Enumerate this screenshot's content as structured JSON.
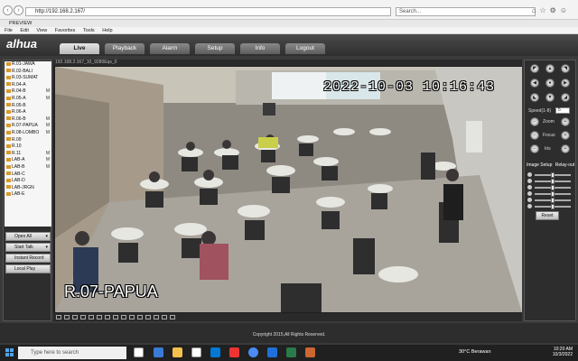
{
  "browser": {
    "address": "http://192.168.2.167/",
    "search_placeholder": "Search...",
    "tab_title": "PREVIEW",
    "menu": [
      "File",
      "Edit",
      "View",
      "Favorites",
      "Tools",
      "Help"
    ]
  },
  "app": {
    "logo": "alhua",
    "tabs": [
      "Live",
      "Playback",
      "Alarm",
      "Setup",
      "Info",
      "Logout"
    ],
    "active_tab": "Live",
    "copyright": "Copyright 2015,All Rights Reserved."
  },
  "cameras": [
    {
      "label": "R.01-JAWA",
      "m": false
    },
    {
      "label": "R.02-BALI",
      "m": false
    },
    {
      "label": "R.03-SUMAT",
      "m": false
    },
    {
      "label": "R.04-A",
      "m": false
    },
    {
      "label": "R.04-B",
      "m": true
    },
    {
      "label": "R.05-A",
      "m": true
    },
    {
      "label": "R.05-B",
      "m": false
    },
    {
      "label": "R.06-A",
      "m": false
    },
    {
      "label": "R.06-B",
      "m": true
    },
    {
      "label": "R.07-PAPUA",
      "m": true
    },
    {
      "label": "R.08-LOMBO",
      "m": true
    },
    {
      "label": "R.09",
      "m": false
    },
    {
      "label": "R.10",
      "m": false
    },
    {
      "label": "R.11",
      "m": true
    },
    {
      "label": "LAB-A",
      "m": true
    },
    {
      "label": "LAB-B",
      "m": true
    },
    {
      "label": "LAB-C",
      "m": false
    },
    {
      "label": "LAB-D",
      "m": false
    },
    {
      "label": "LAB-JRGN",
      "m": false
    },
    {
      "label": "LAB-E",
      "m": false
    }
  ],
  "camera_m_label": "M",
  "controls": {
    "open_all": "Open All",
    "start_talk": "Start Talk",
    "instant_record": "Instant Record",
    "local_play": "Local Play"
  },
  "video": {
    "title": "192.168.2.167_10_9280Eqs_0",
    "timestamp": "2022-10-03 10:16:43",
    "room_name": "R.07-PAPUA"
  },
  "ptz": {
    "speed_label": "Speed(1-8)",
    "speed_value": "5",
    "zoom_label": "Zoom",
    "focus_label": "Focus",
    "iris_label": "Iris"
  },
  "image_setup": {
    "tab1": "Image Setup",
    "tab2": "Relay-out",
    "reset": "Reset",
    "slider_levels": [
      0.5,
      0.5,
      0.5,
      0.5,
      0.5,
      0.5
    ]
  },
  "taskbar": {
    "search_placeholder": "Type here to search",
    "weather": "30°C  Berawan",
    "time": "10:20 AM",
    "date": "10/3/2022"
  }
}
